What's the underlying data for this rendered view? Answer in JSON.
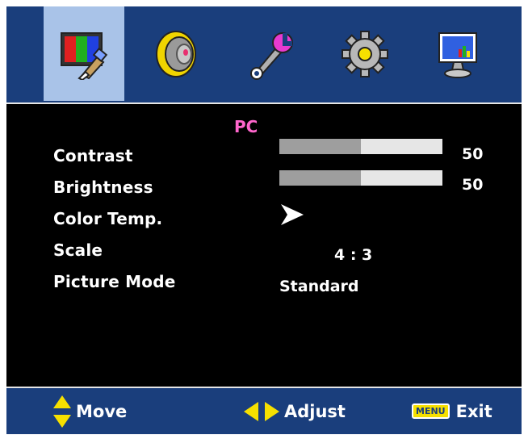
{
  "tabs": [
    {
      "icon": "picture-icon",
      "selected": true
    },
    {
      "icon": "speaker-icon",
      "selected": false
    },
    {
      "icon": "wrench-icon",
      "selected": false
    },
    {
      "icon": "gear-icon",
      "selected": false
    },
    {
      "icon": "monitor-icon",
      "selected": false
    }
  ],
  "panel": {
    "source": "PC",
    "contrast": {
      "label": "Contrast",
      "value": "50",
      "level": 0.5
    },
    "brightness": {
      "label": "Brightness",
      "value": "50",
      "level": 0.5
    },
    "color_temp": {
      "label": "Color Temp.",
      "icon": "arrow-right-icon"
    },
    "scale": {
      "label": "Scale",
      "value": "4 : 3"
    },
    "picture_mode": {
      "label": "Picture Mode",
      "value": "Standard"
    }
  },
  "footer": {
    "move": {
      "icon": "up-down-arrow-icon",
      "label": "Move"
    },
    "adjust": {
      "icon": "left-right-arrow-icon",
      "label": "Adjust"
    },
    "exit": {
      "key": "MENU",
      "label": "Exit"
    }
  },
  "colors": {
    "bar_background": "#1a3e7c",
    "selected_tab": "#a9c3e8",
    "source_label": "#ff66cc",
    "arrow_yellow": "#f6e000"
  }
}
